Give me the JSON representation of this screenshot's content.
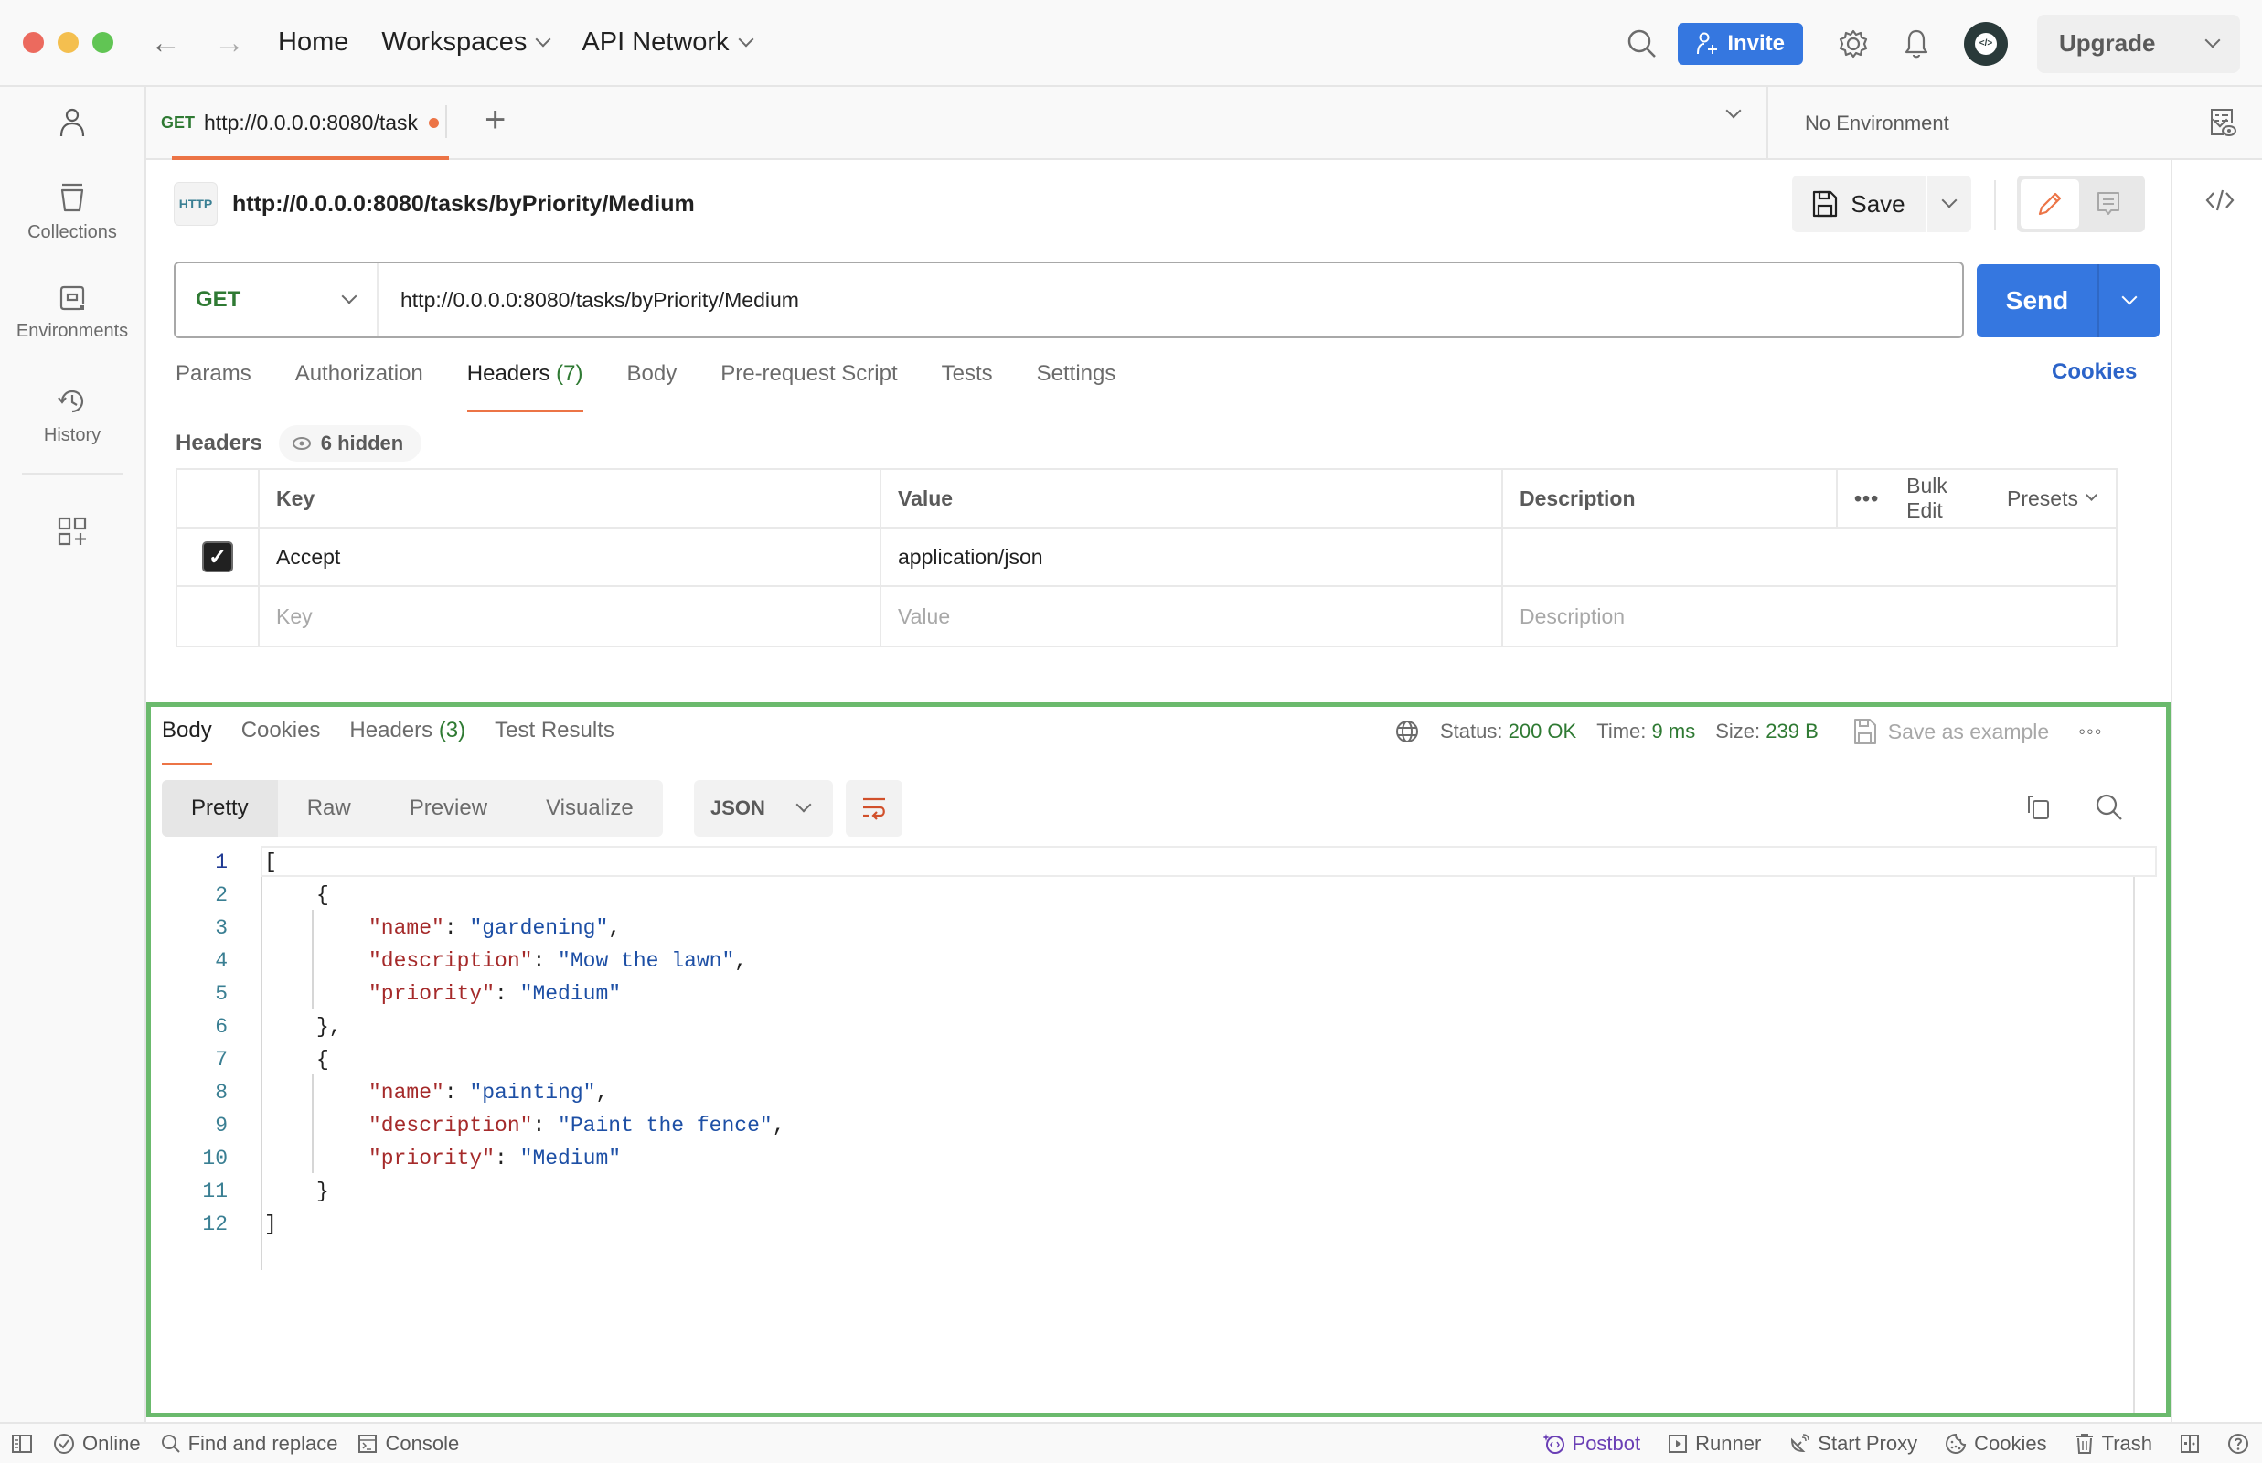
{
  "titlebar": {
    "nav": {
      "back": "back-arrow",
      "forward": "forward-arrow"
    },
    "home": "Home",
    "workspaces": "Workspaces",
    "api_network": "API Network",
    "invite": "Invite",
    "upgrade": "Upgrade"
  },
  "sidebar": {
    "items": [
      {
        "label": "",
        "icon": "user-icon"
      },
      {
        "label": "Collections",
        "icon": "collections-icon"
      },
      {
        "label": "Environments",
        "icon": "environments-icon"
      },
      {
        "label": "History",
        "icon": "history-icon"
      },
      {
        "label": "",
        "icon": "add-widgets-icon"
      }
    ]
  },
  "tabs": {
    "open": [
      {
        "method": "GET",
        "label": "http://0.0.0.0:8080/task",
        "unsaved": true
      }
    ],
    "environment": "No Environment"
  },
  "request": {
    "title": "http://0.0.0.0:8080/tasks/byPriority/Medium",
    "save": "Save",
    "method": "GET",
    "url": "http://0.0.0.0:8080/tasks/byPriority/Medium",
    "send": "Send",
    "tabs": [
      {
        "label": "Params"
      },
      {
        "label": "Authorization"
      },
      {
        "label": "Headers",
        "count": "(7)",
        "active": true
      },
      {
        "label": "Body"
      },
      {
        "label": "Pre-request Script"
      },
      {
        "label": "Tests"
      },
      {
        "label": "Settings"
      }
    ],
    "cookies": "Cookies",
    "headers_label": "Headers",
    "hidden": "6 hidden",
    "table": {
      "columns": [
        "Key",
        "Value",
        "Description"
      ],
      "actions": {
        "bulk_edit": "Bulk Edit",
        "presets": "Presets"
      },
      "rows": [
        {
          "checked": true,
          "key": "Accept",
          "value": "application/json",
          "description": ""
        }
      ],
      "placeholders": {
        "key": "Key",
        "value": "Value",
        "description": "Description"
      }
    }
  },
  "response": {
    "tabs": [
      {
        "label": "Body",
        "active": true
      },
      {
        "label": "Cookies"
      },
      {
        "label": "Headers",
        "count": "(3)"
      },
      {
        "label": "Test Results"
      }
    ],
    "status_label": "Status:",
    "status": "200 OK",
    "time_label": "Time:",
    "time": "9 ms",
    "size_label": "Size:",
    "size": "239 B",
    "save_example": "Save as example",
    "views": [
      "Pretty",
      "Raw",
      "Preview",
      "Visualize"
    ],
    "active_view": "Pretty",
    "format": "JSON",
    "body_lines": [
      {
        "n": "1",
        "indent": 0,
        "text": "["
      },
      {
        "n": "2",
        "indent": 1,
        "text": "{"
      },
      {
        "n": "3",
        "indent": 2,
        "key": "\"name\"",
        "val": "\"gardening\"",
        "tail": ","
      },
      {
        "n": "4",
        "indent": 2,
        "key": "\"description\"",
        "val": "\"Mow the lawn\"",
        "tail": ","
      },
      {
        "n": "5",
        "indent": 2,
        "key": "\"priority\"",
        "val": "\"Medium\"",
        "tail": ""
      },
      {
        "n": "6",
        "indent": 1,
        "text": "},"
      },
      {
        "n": "7",
        "indent": 1,
        "text": "{"
      },
      {
        "n": "8",
        "indent": 2,
        "key": "\"name\"",
        "val": "\"painting\"",
        "tail": ","
      },
      {
        "n": "9",
        "indent": 2,
        "key": "\"description\"",
        "val": "\"Paint the fence\"",
        "tail": ","
      },
      {
        "n": "10",
        "indent": 2,
        "key": "\"priority\"",
        "val": "\"Medium\"",
        "tail": ""
      },
      {
        "n": "11",
        "indent": 1,
        "text": "}"
      },
      {
        "n": "12",
        "indent": 0,
        "text": "]"
      }
    ]
  },
  "statusbar": {
    "online": "Online",
    "find_replace": "Find and replace",
    "console": "Console",
    "postbot": "Postbot",
    "runner": "Runner",
    "start_proxy": "Start Proxy",
    "cookies": "Cookies",
    "trash": "Trash"
  },
  "colors": {
    "accent_blue": "#3577e0",
    "active_orange": "#ec7446",
    "success_green": "#2f7a33",
    "highlight_border": "#6bba6d",
    "postbot_purple": "#6a3fb5"
  }
}
